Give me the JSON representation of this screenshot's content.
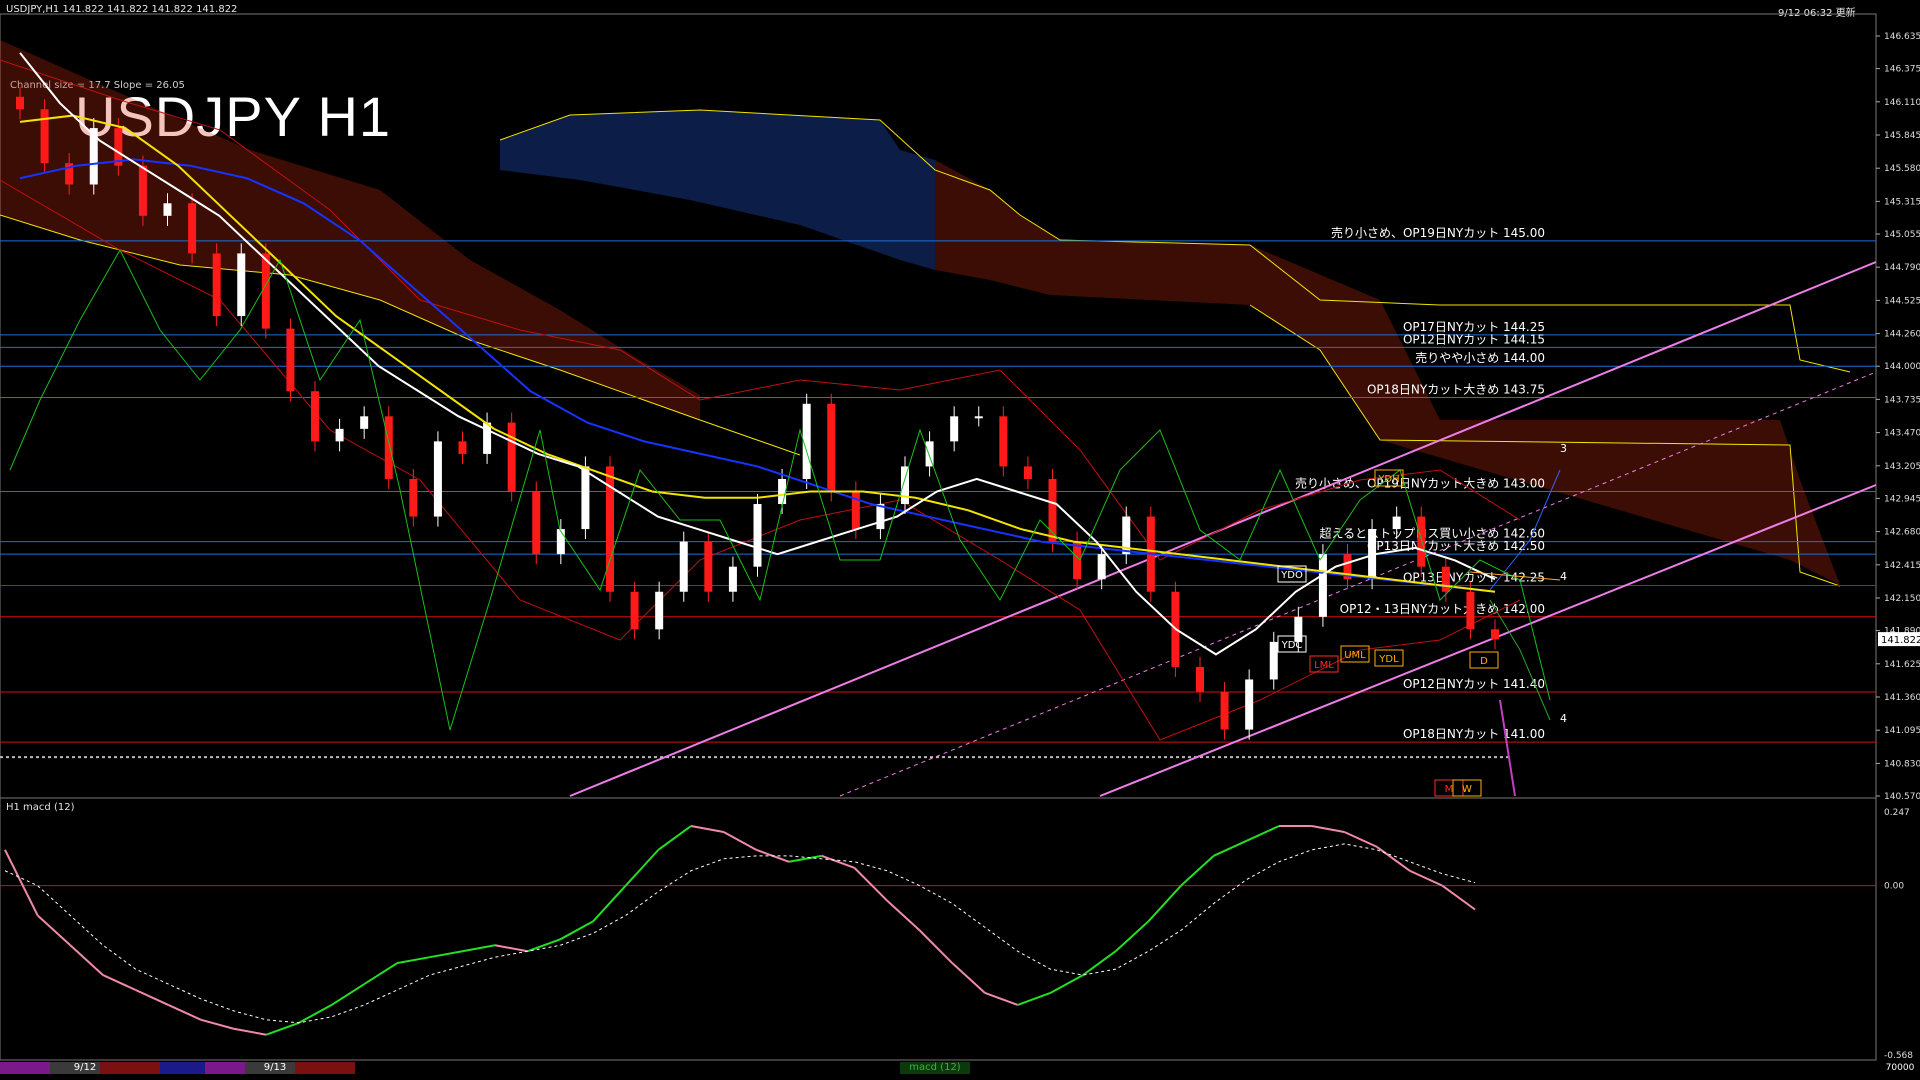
{
  "header": {
    "symbol_info": "USDJPY,H1  141.822 141.822 141.822 141.822",
    "timestamp": "9/12 06:32 更新",
    "title": "USDJPY H1",
    "channel_info": "Channel size = 17.7  Slope = 26.05"
  },
  "colors": {
    "background": "#000000",
    "grid_level_blue": "#1f6fd6",
    "grid_level_red": "#d11010",
    "cloud_red": "#d93010",
    "cloud_blue": "#2a6cff",
    "ma_white": "#ffffff",
    "ma_yellow": "#f2e400",
    "ma_blue": "#1733ff",
    "chikou_green": "#19c019",
    "bollinger_red": "#c01010",
    "channel_pink": "#ee7ee8",
    "macd_green": "#22e022",
    "macd_pink": "#f08aa8",
    "price_label_bg": "#ffffff"
  },
  "price_axis": {
    "ticks": [
      "146.635",
      "146.375",
      "146.110",
      "145.845",
      "145.580",
      "145.315",
      "145.055",
      "144.790",
      "144.525",
      "144.260",
      "144.000",
      "143.735",
      "143.470",
      "143.205",
      "142.945",
      "142.680",
      "142.415",
      "142.150",
      "141.890",
      "141.625",
      "141.360",
      "141.095",
      "140.830",
      "140.570"
    ],
    "current": "141.822"
  },
  "levels": [
    {
      "label": "売り小さめ、OP19日NYカット 145.00",
      "color": "blue"
    },
    {
      "label": "OP17日NYカット 144.25",
      "color": "blue"
    },
    {
      "label": "OP12日NYカット 144.15",
      "color": "blue"
    },
    {
      "label": "売りやや小さめ 144.00",
      "color": "blue"
    },
    {
      "label": "OP18日NYカット大きめ 143.75",
      "color": "blue"
    },
    {
      "label": "売り小さめ、OP19日NYカット大きめ 143.00",
      "color": "blue"
    },
    {
      "label": "超えるとストップロス買い小さめ 142.60",
      "color": "blue"
    },
    {
      "label": "OP13日NYカット大きめ 142.50",
      "color": "blue"
    },
    {
      "label": "OP13日NYカット 142.25",
      "color": "red"
    },
    {
      "label": "OP12・13日NYカット大きめ 142.00",
      "color": "red"
    },
    {
      "label": "OP12日NYカット 141.40",
      "color": "red"
    },
    {
      "label": "OP18日NYカット 141.00",
      "color": "red"
    }
  ],
  "boxes": [
    "YDO",
    "YDC",
    "YDH",
    "YDL",
    "LML",
    "UML",
    "D",
    "M",
    "W"
  ],
  "wave_labels": [
    "3",
    "4",
    "4"
  ],
  "macd": {
    "label": "H1  macd (12)",
    "ticks": [
      "0.247",
      "0.00",
      "-0.568"
    ]
  },
  "time_axis": {
    "labels": [
      "9/12",
      "9/13"
    ],
    "indicator_label": "macd (12)",
    "right_label": "70000"
  },
  "chart_data": {
    "type": "line",
    "title": "USDJPY H1",
    "ylim": [
      140.57,
      146.635
    ],
    "series": [
      {
        "name": "price_close",
        "values": [
          146.05,
          145.62,
          145.45,
          145.9,
          145.6,
          145.2,
          145.3,
          144.9,
          144.4,
          144.9,
          144.3,
          143.8,
          143.4,
          143.5,
          143.6,
          143.1,
          142.8,
          143.4,
          143.3,
          143.55,
          143.0,
          142.5,
          142.7,
          143.2,
          142.2,
          141.9,
          142.2,
          142.6,
          142.2,
          142.4,
          142.9,
          143.1,
          143.7,
          143.0,
          142.7,
          142.9,
          143.2,
          143.4,
          143.6,
          143.6,
          143.2,
          143.1,
          142.6,
          142.3,
          142.5,
          142.8,
          142.2,
          141.6,
          141.4,
          141.1,
          141.5,
          141.8,
          142.0,
          142.5,
          142.3,
          142.7,
          142.8,
          142.4,
          142.2,
          141.9,
          141.82
        ]
      },
      {
        "name": "sma_white",
        "values": [
          146.5,
          146.1,
          145.8,
          145.6,
          145.4,
          145.2,
          144.9,
          144.6,
          144.3,
          144.0,
          143.8,
          143.6,
          143.45,
          143.3,
          143.2,
          143.0,
          142.8,
          142.7,
          142.6,
          142.5,
          142.6,
          142.7,
          142.8,
          143.0,
          143.1,
          143.0,
          142.9,
          142.6,
          142.2,
          141.9,
          141.7,
          141.9,
          142.2,
          142.4,
          142.5,
          142.55,
          142.45,
          142.3
        ]
      },
      {
        "name": "sma_yellow",
        "values": [
          145.95,
          146.0,
          145.9,
          145.6,
          145.2,
          144.8,
          144.4,
          144.1,
          143.8,
          143.5,
          143.3,
          143.15,
          143.0,
          142.95,
          142.95,
          143.0,
          143.0,
          142.95,
          142.85,
          142.7,
          142.6,
          142.55,
          142.5,
          142.45,
          142.4,
          142.35,
          142.3,
          142.25,
          142.2
        ]
      },
      {
        "name": "sma_blue",
        "values": [
          145.5,
          145.6,
          145.65,
          145.6,
          145.5,
          145.3,
          145.0,
          144.6,
          144.2,
          143.8,
          143.55,
          143.4,
          143.3,
          143.2,
          143.05,
          142.9,
          142.8,
          142.7,
          142.6,
          142.55,
          142.5,
          142.45,
          142.4,
          142.35,
          142.3,
          142.25,
          142.2
        ]
      }
    ],
    "macd": {
      "main": [
        0.12,
        -0.1,
        -0.2,
        -0.3,
        -0.35,
        -0.4,
        -0.45,
        -0.48,
        -0.5,
        -0.46,
        -0.4,
        -0.33,
        -0.26,
        -0.24,
        -0.22,
        -0.2,
        -0.22,
        -0.18,
        -0.12,
        0.0,
        0.12,
        0.2,
        0.18,
        0.12,
        0.08,
        0.1,
        0.06,
        -0.05,
        -0.15,
        -0.26,
        -0.36,
        -0.4,
        -0.36,
        -0.3,
        -0.22,
        -0.12,
        0.0,
        0.1,
        0.15,
        0.2,
        0.2,
        0.18,
        0.13,
        0.05,
        0.0,
        -0.08
      ],
      "signal": [
        0.05,
        0.0,
        -0.1,
        -0.2,
        -0.28,
        -0.33,
        -0.38,
        -0.42,
        -0.45,
        -0.46,
        -0.44,
        -0.4,
        -0.35,
        -0.3,
        -0.27,
        -0.24,
        -0.22,
        -0.2,
        -0.16,
        -0.1,
        -0.02,
        0.05,
        0.09,
        0.1,
        0.1,
        0.09,
        0.08,
        0.05,
        0.0,
        -0.06,
        -0.14,
        -0.22,
        -0.28,
        -0.3,
        -0.28,
        -0.22,
        -0.15,
        -0.06,
        0.02,
        0.08,
        0.12,
        0.14,
        0.12,
        0.08,
        0.04,
        0.01
      ]
    }
  }
}
